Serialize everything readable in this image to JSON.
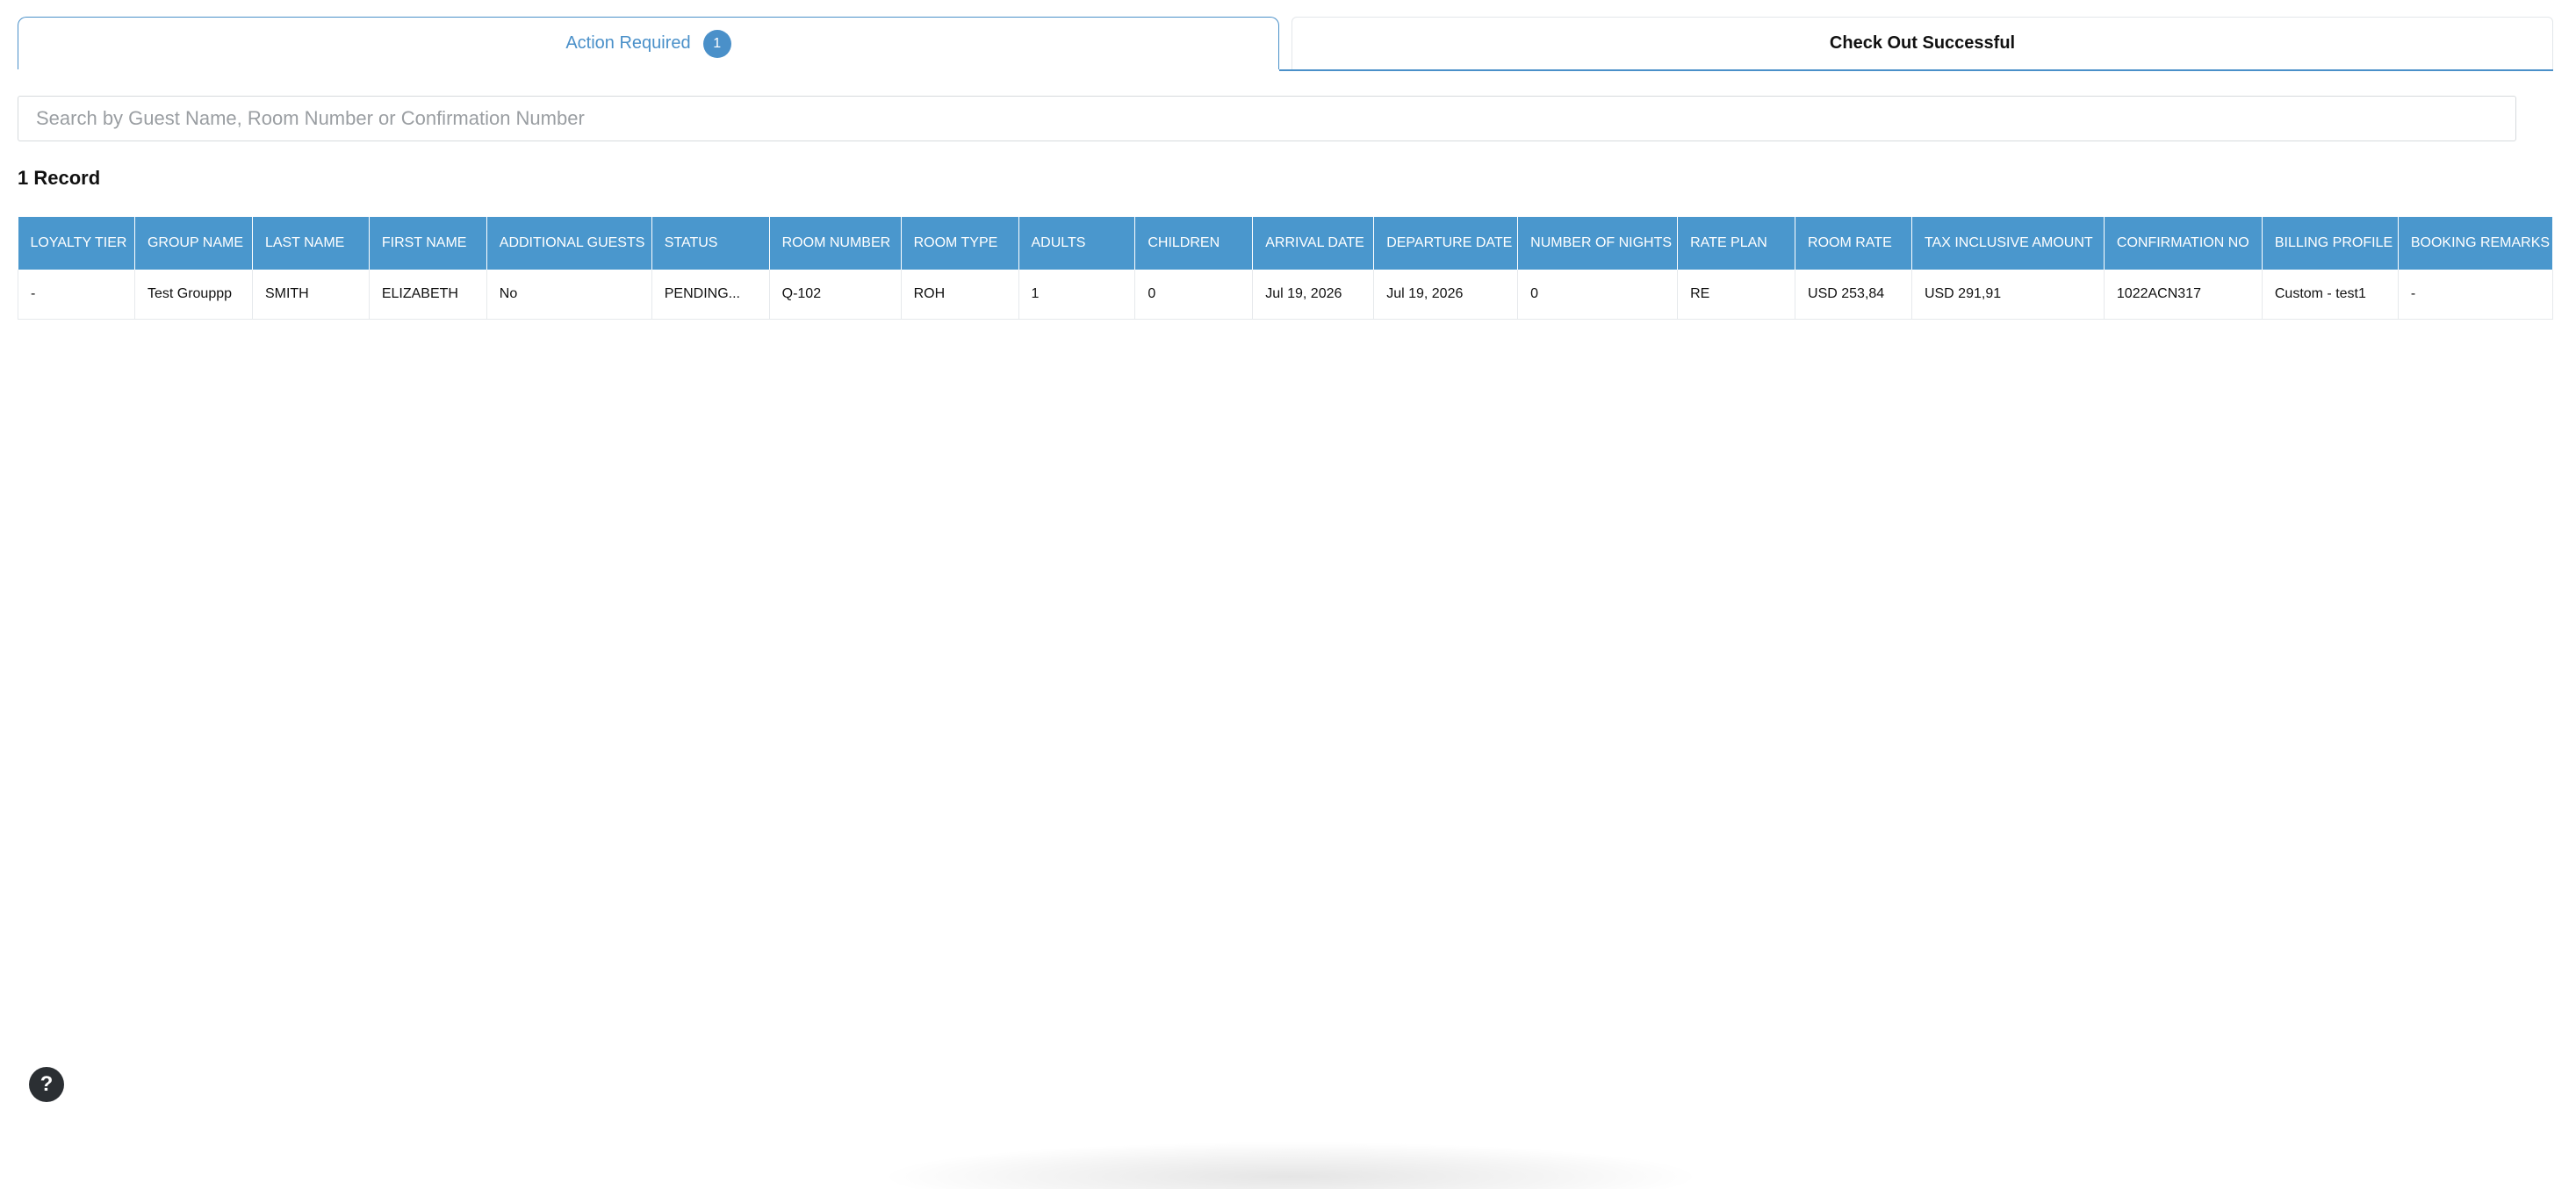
{
  "tabs": {
    "action_required": {
      "label": "Action Required",
      "count": "1"
    },
    "check_out_successful": {
      "label": "Check Out Successful"
    }
  },
  "search": {
    "placeholder": "Search by Guest Name, Room Number or Confirmation Number",
    "value": ""
  },
  "record_count": "1 Record",
  "table": {
    "columns": [
      "LOYALTY TIER",
      "GROUP NAME",
      "LAST NAME",
      "FIRST NAME",
      "ADDITIONAL GUESTS",
      "STATUS",
      "ROOM NUMBER",
      "ROOM TYPE",
      "ADULTS",
      "CHILDREN",
      "ARRIVAL DATE",
      "DEPARTURE DATE",
      "NUMBER OF NIGHTS",
      "RATE PLAN",
      "ROOM RATE",
      "TAX INCLUSIVE AMOUNT",
      "CONFIRMATION NO",
      "BILLING PROFILE",
      "BOOKING REMARKS"
    ],
    "rows": [
      [
        "-",
        "Test Grouppp",
        "SMITH",
        "ELIZABETH",
        "No",
        "PENDING...",
        "Q-102",
        "ROH",
        "1",
        "0",
        "Jul 19, 2026",
        "Jul 19, 2026",
        "0",
        "RE",
        "USD 253,84",
        "USD 291,91",
        "1022ACN317",
        "Custom - test1",
        "-"
      ]
    ]
  },
  "help": {
    "label": "?",
    "icon": "help-icon"
  },
  "colors": {
    "accent": "#4a90c9",
    "header_bg": "#4a97cd"
  }
}
